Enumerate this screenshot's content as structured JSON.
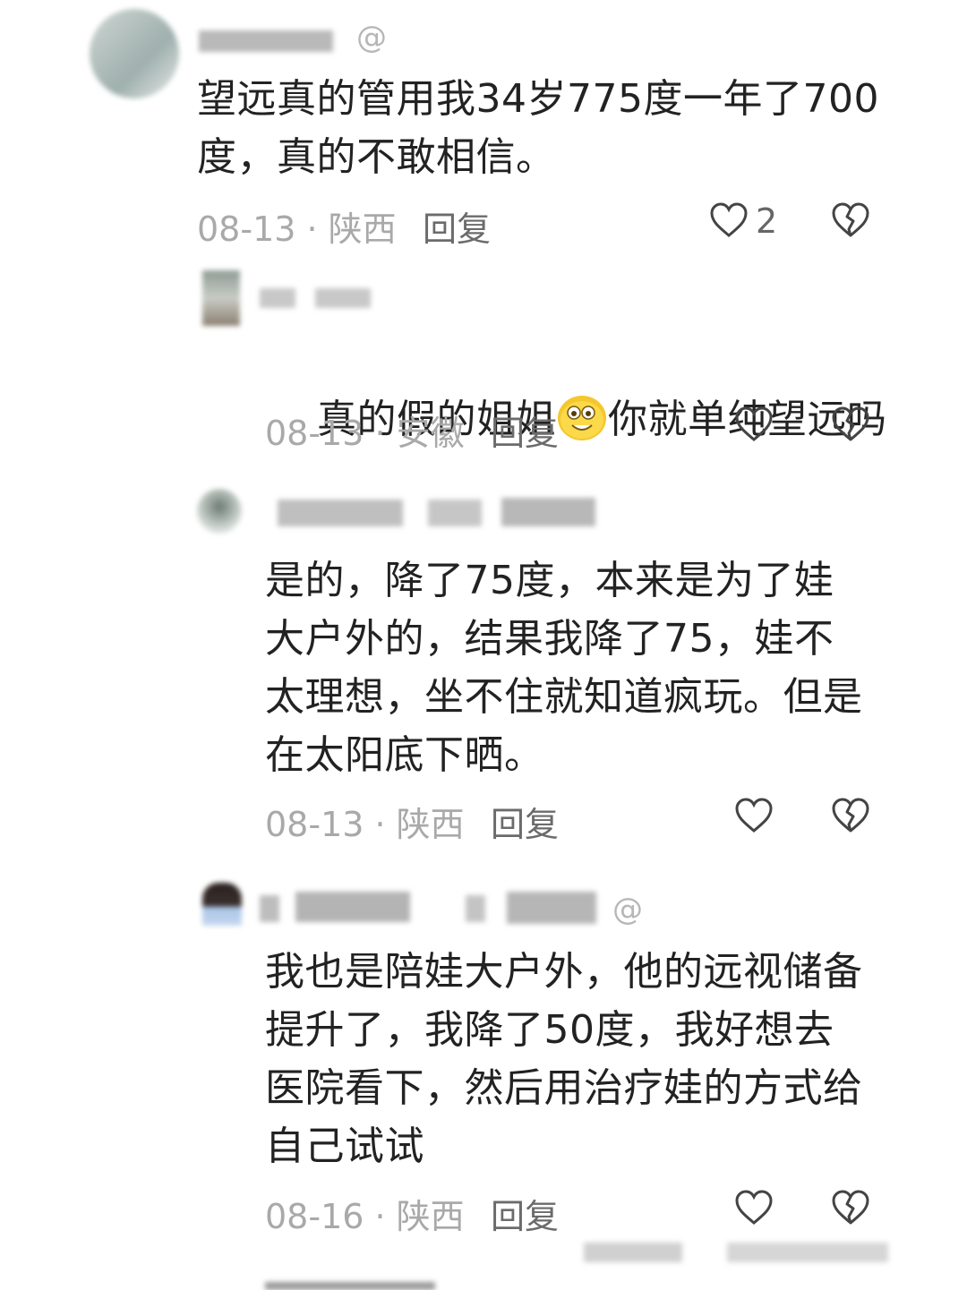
{
  "comments": [
    {
      "text": "望远真的管用我34岁775度一年了700\n度，真的不敢相信。",
      "date": "08-13",
      "location": "陕西",
      "reply_label": "回复",
      "like_count": "2",
      "username_suffix": "@"
    },
    {
      "text_before": "真的假的姐姐",
      "text_after": "你就单纯望远吗",
      "date": "08-13",
      "location": "安徽",
      "reply_label": "回复"
    },
    {
      "text": "是的，降了75度，本来是为了娃\n大户外的，结果我降了75，娃不\n太理想，坐不住就知道疯玩。但是\n在太阳底下晒。",
      "date": "08-13",
      "location": "陕西",
      "reply_label": "回复"
    },
    {
      "text": "我也是陪娃大户外，他的远视储备\n提升了，我降了50度，我好想去\n医院看下，然后用治疗娃的方式给\n自己试试",
      "date": "08-16",
      "location": "陕西",
      "reply_label": "回复",
      "username_suffix": "@"
    }
  ],
  "icons": {
    "like": "heart-outline-icon",
    "dislike": "broken-heart-icon",
    "emoji": "grinning-face-emoji"
  },
  "meta_separator": " · "
}
